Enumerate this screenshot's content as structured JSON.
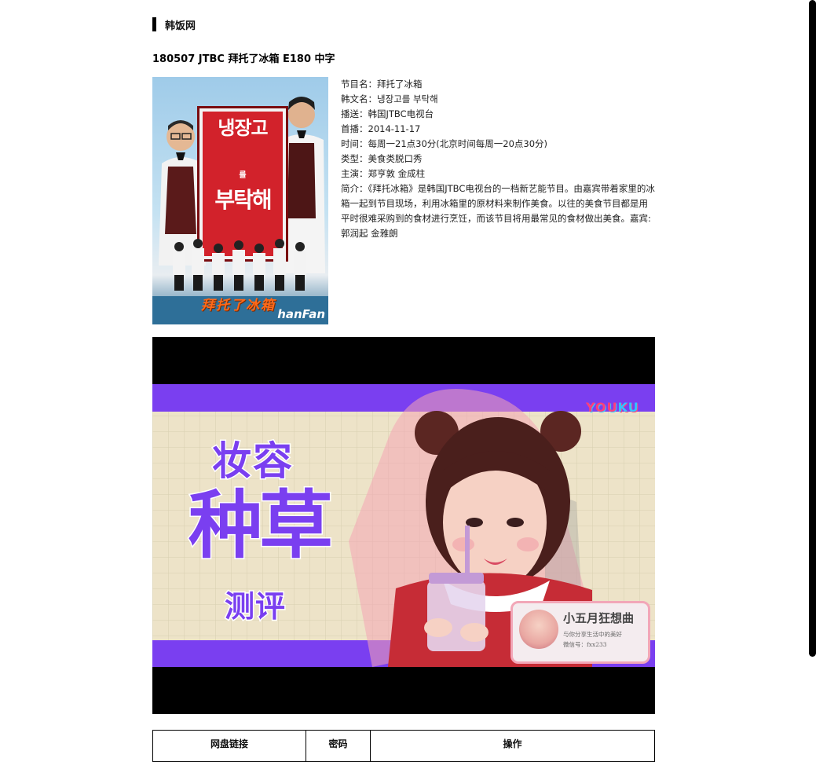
{
  "breadcrumb": {
    "site_name": "韩饭网"
  },
  "article": {
    "title": "180507 JTBC 拜托了冰箱 E180 中字"
  },
  "poster": {
    "sign_line1": "냉장고",
    "sign_line2": "를",
    "sign_line3": "부탁해",
    "chinese_title": "拜托了冰箱",
    "logo": "hanFan"
  },
  "info": {
    "program_name": "节目名：拜托了冰箱",
    "korean_name": "韩文名：냉장고를 부탁해",
    "broadcaster": "播送：韩国JTBC电视台",
    "premiere": "首播：2014-11-17",
    "schedule": "时间：每周一21点30分(北京时间每周一20点30分)",
    "genre": "类型：美食类脱口秀",
    "hosts": "主演：郑亨敦 金成柱",
    "synopsis": "简介：《拜托冰箱》是韩国JTBC电视台的一档新艺能节目。由嘉宾带着家里的冰箱一起到节目现场，利用冰箱里的原材料来制作美食。以往的美食节目都是用平时很难采购到的食材进行烹饪，而该节目将用最常见的食材做出美食。嘉宾: 郭润起 金雅朗"
  },
  "video": {
    "youku_logo_a": "YOU",
    "youku_logo_b": "KU",
    "headline_1": "妆容",
    "headline_2": "种草",
    "headline_3": "测评",
    "badge_name": "小五月狂想曲",
    "badge_tagline": "与你分享生活中的美好",
    "badge_wechat": "微信号：fxx233",
    "accent_color": "#7a3ff0"
  },
  "table": {
    "headers": [
      "网盘链接",
      "密码",
      "操作"
    ]
  }
}
